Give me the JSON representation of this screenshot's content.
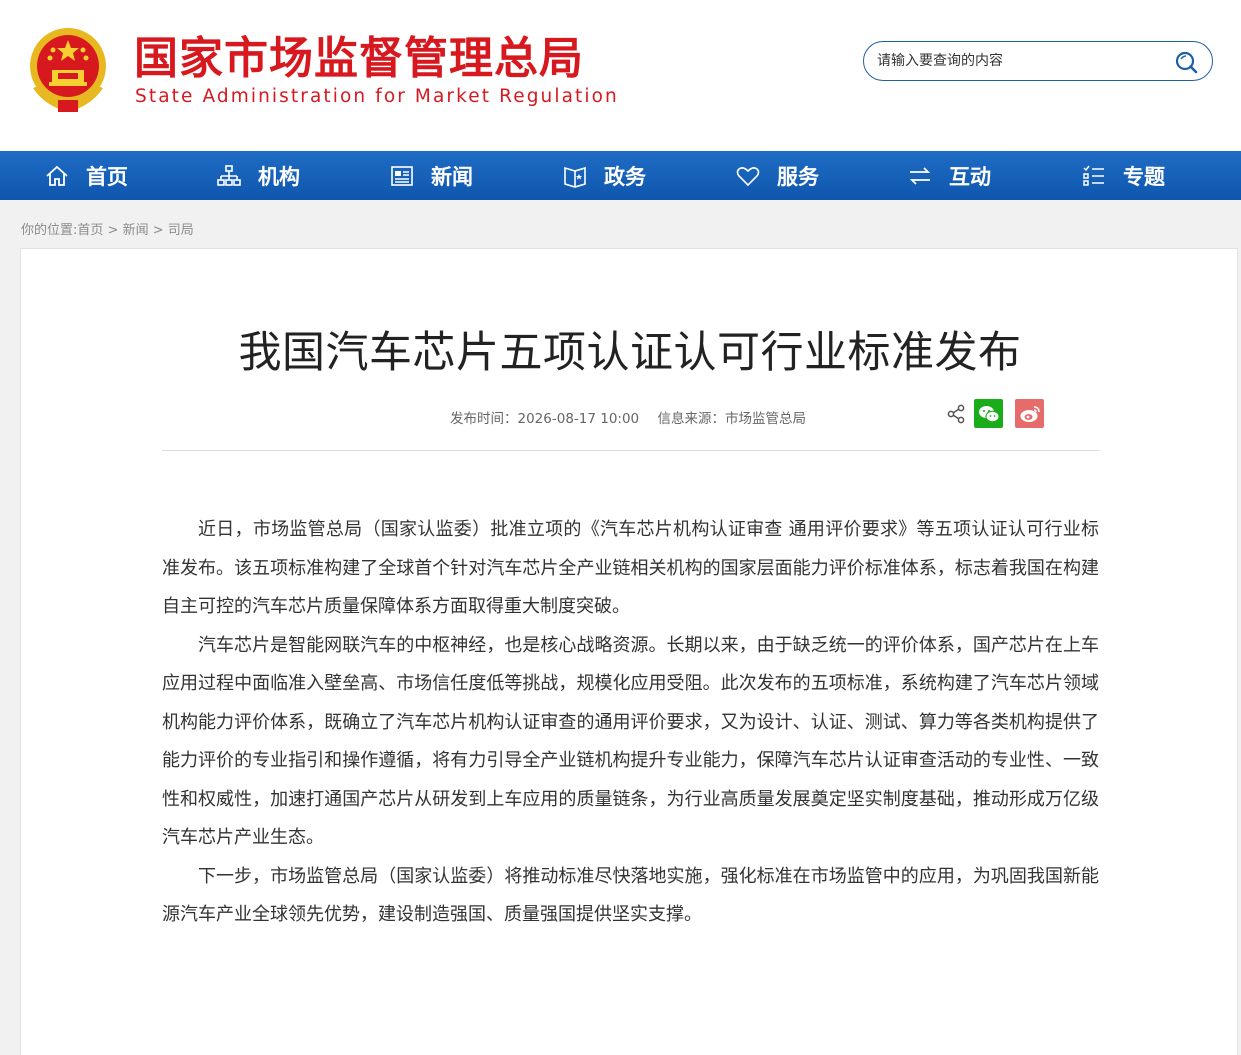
{
  "header": {
    "site_name_cn": "国家市场监督管理总局",
    "site_name_en": "State Administration for Market Regulation",
    "emblem_icon": "national-emblem-icon",
    "brand_color": "#d7191f"
  },
  "search": {
    "placeholder": "请输入要查询的内容",
    "icon": "search-icon"
  },
  "nav": {
    "background": "#1a63bb",
    "items": [
      {
        "label": "首页",
        "icon": "home-icon"
      },
      {
        "label": "机构",
        "icon": "org-chart-icon"
      },
      {
        "label": "新闻",
        "icon": "newspaper-icon"
      },
      {
        "label": "政务",
        "icon": "book-icon"
      },
      {
        "label": "服务",
        "icon": "heart-icon"
      },
      {
        "label": "互动",
        "icon": "exchange-icon"
      },
      {
        "label": "专题",
        "icon": "list-icon"
      }
    ]
  },
  "breadcrumb": {
    "prefix": "你的位置:",
    "items": [
      "首页",
      "新闻",
      "司局"
    ],
    "separator": " > "
  },
  "article": {
    "title": "我国汽车芯片五项认证认可行业标准发布",
    "publish_time": "发布时间：2026-08-17 10:00",
    "source": "信息来源：市场监管总局",
    "share_icons": [
      "share-icon",
      "wechat-icon",
      "weibo-icon"
    ],
    "paragraphs": [
      "近日，市场监管总局（国家认监委）批准立项的《汽车芯片机构认证审查 通用评价要求》等五项认证认可行业标准发布。该五项标准构建了全球首个针对汽车芯片全产业链相关机构的国家层面能力评价标准体系，标志着我国在构建自主可控的汽车芯片质量保障体系方面取得重大制度突破。",
      "汽车芯片是智能网联汽车的中枢神经，也是核心战略资源。长期以来，由于缺乏统一的评价体系，国产芯片在上车应用过程中面临准入壁垒高、市场信任度低等挑战，规模化应用受阻。此次发布的五项标准，系统构建了汽车芯片领域机构能力评价体系，既确立了汽车芯片机构认证审查的通用评价要求，又为设计、认证、测试、算力等各类机构提供了能力评价的专业指引和操作遵循，将有力引导全产业链机构提升专业能力，保障汽车芯片认证审查活动的专业性、一致性和权威性，加速打通国产芯片从研发到上车应用的质量链条，为行业高质量发展奠定坚实制度基础，推动形成万亿级汽车芯片产业生态。",
      "下一步，市场监管总局（国家认监委）将推动标准尽快落地实施，强化标准在市场监管中的应用，为巩固我国新能源汽车产业全球领先优势，建设制造强国、质量强国提供坚实支撑。"
    ]
  }
}
